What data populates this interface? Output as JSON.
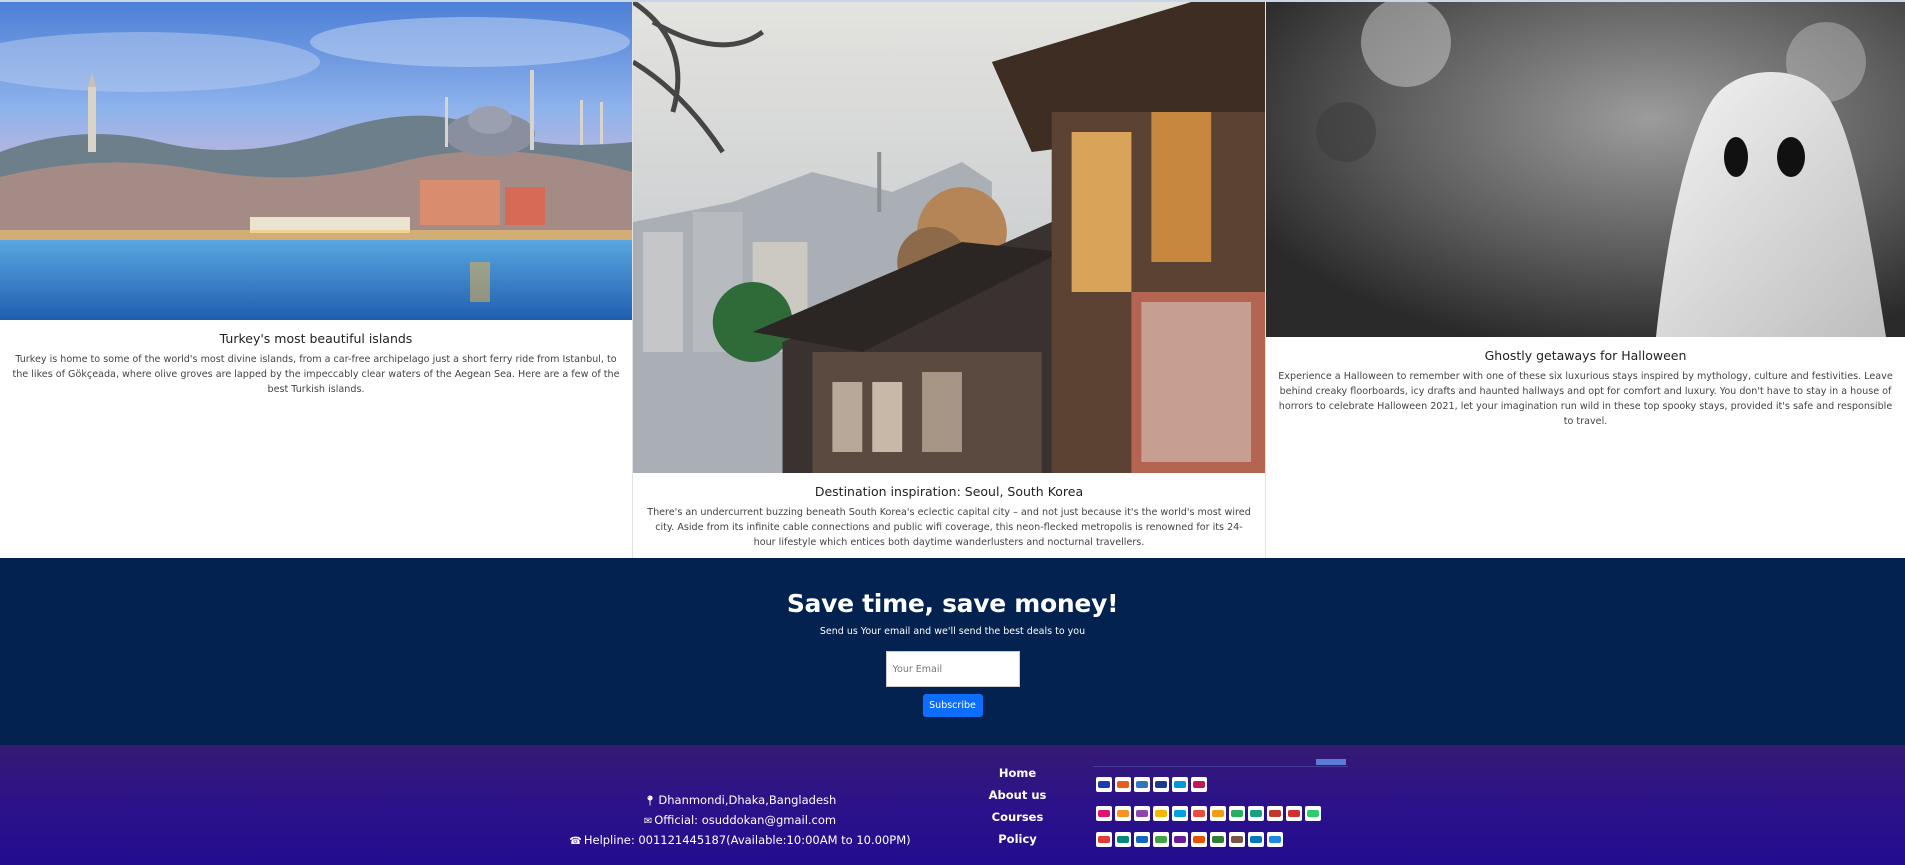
{
  "cards": [
    {
      "title": "Turkey's most beautiful islands",
      "text": "Turkey is home to some of the world's most divine islands, from a car-free archipelago just a short ferry ride from Istanbul, to the likes of Gökçeada, where olive groves are lapped by the impeccably clear waters of the Aegean Sea. Here are a few of the best Turkish islands."
    },
    {
      "title": "Destination inspiration: Seoul, South Korea",
      "text": "There's an undercurrent buzzing beneath South Korea's eclectic capital city – and not just because it's the world's most wired city. Aside from its infinite cable connections and public wifi coverage, this neon-flecked metropolis is renowned for its 24-hour lifestyle which entices both daytime wanderlusters and nocturnal travellers."
    },
    {
      "title": "Ghostly getaways for Halloween",
      "text": "Experience a Halloween to remember with one of these six luxurious stays inspired by mythology, culture and festivities. Leave behind creaky floorboards, icy drafts and haunted hallways and opt for comfort and luxury. You don't have to stay in a house of horrors to celebrate Halloween 2021, let your imagination run wild in these top spooky stays, provided it's safe and responsible to travel."
    }
  ],
  "newsletter": {
    "title": "Save time, save money!",
    "subtitle": "Send us Your email and we'll send the best deals to you",
    "email_placeholder": "Your Email",
    "button": "Subscribe"
  },
  "footer": {
    "address": "Dhanmondi,Dhaka,Bangladesh",
    "email": "Official: osuddokan@gmail.com",
    "helpline": "Helpline: 001121445187(Available:10:00AM to 10.00PM)",
    "links": [
      "Home",
      "About us",
      "Courses",
      "Policy"
    ],
    "icons": [
      "map-marker-icon",
      "envelope-icon",
      "phone-icon"
    ]
  },
  "payment_logo_colors": {
    "row1": [
      "#1a3fb0",
      "#eb5a1e",
      "#2e77bc",
      "#1e3a8a",
      "#0098d8",
      "#c2185b"
    ],
    "row2": [
      "#e2136e",
      "#f7931e",
      "#8e44ad",
      "#f5b800",
      "#00a0e3",
      "#e74c3c",
      "#f39c12",
      "#27ae60",
      "#16a085",
      "#c0392b",
      "#d32f2f",
      "#2ecc71"
    ],
    "row3": [
      "#e53935",
      "#00897b",
      "#1565c0",
      "#43a047",
      "#6a1b9a",
      "#e65100",
      "#2e7d32",
      "#795548",
      "#0277bd",
      "#1e88e5"
    ]
  }
}
